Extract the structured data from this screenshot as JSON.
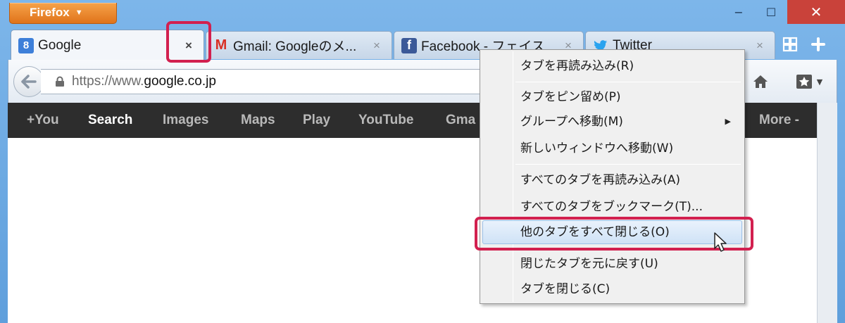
{
  "window": {
    "app_button": "Firefox",
    "controls": {
      "minimize": "−",
      "maximize": "☐",
      "close": "✕"
    }
  },
  "tabs": [
    {
      "title": "Google",
      "favicon": "google-favicon-icon",
      "favicon_text": "8",
      "active": true,
      "close": "×"
    },
    {
      "title": "Gmail: Googleのメ...",
      "favicon": "gmail-favicon-icon",
      "favicon_text": "M",
      "active": false,
      "close": "×"
    },
    {
      "title": "Facebook - フェイス",
      "favicon": "facebook-favicon-icon",
      "favicon_text": "f",
      "active": false,
      "close": "×"
    },
    {
      "title": "Twitter",
      "favicon": "twitter-favicon-icon",
      "favicon_text": "",
      "active": false,
      "close": "×"
    }
  ],
  "navbar": {
    "url_prefix": "https://www.",
    "url_domain": "google.co.jp",
    "url_suffix": ""
  },
  "google_bar": {
    "items": [
      "+You",
      "Search",
      "Images",
      "Maps",
      "Play",
      "YouTube",
      "Gma",
      "More -"
    ],
    "selected": "Search"
  },
  "context_menu": {
    "items": [
      "タブを再読み込み(R)",
      "タブをピン留め(P)",
      "グループへ移動(M)",
      "新しいウィンドウへ移動(W)",
      "すべてのタブを再読み込み(A)",
      "すべてのタブをブックマーク(T)...",
      "他のタブをすべて閉じる(O)",
      "閉じたタブを元に戻す(U)",
      "タブを閉じる(C)"
    ],
    "hovered_item": "他のタブをすべて閉じる(O)"
  },
  "colors": {
    "highlight": "#d2204f",
    "firefox_orange": "#e0731a",
    "google_bar": "#2d2d2d",
    "window_frame": "#6aa8e0"
  }
}
